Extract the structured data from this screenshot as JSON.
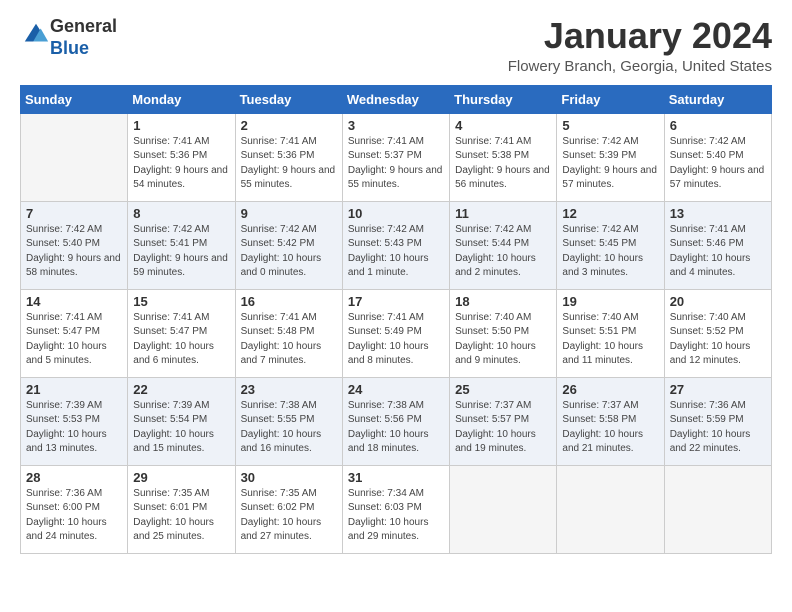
{
  "header": {
    "logo_general": "General",
    "logo_blue": "Blue",
    "title": "January 2024",
    "subtitle": "Flowery Branch, Georgia, United States"
  },
  "days_of_week": [
    "Sunday",
    "Monday",
    "Tuesday",
    "Wednesday",
    "Thursday",
    "Friday",
    "Saturday"
  ],
  "weeks": [
    [
      {
        "day": "",
        "sunrise": "",
        "sunset": "",
        "daylight": "",
        "empty": true
      },
      {
        "day": "1",
        "sunrise": "Sunrise: 7:41 AM",
        "sunset": "Sunset: 5:36 PM",
        "daylight": "Daylight: 9 hours and 54 minutes."
      },
      {
        "day": "2",
        "sunrise": "Sunrise: 7:41 AM",
        "sunset": "Sunset: 5:36 PM",
        "daylight": "Daylight: 9 hours and 55 minutes."
      },
      {
        "day": "3",
        "sunrise": "Sunrise: 7:41 AM",
        "sunset": "Sunset: 5:37 PM",
        "daylight": "Daylight: 9 hours and 55 minutes."
      },
      {
        "day": "4",
        "sunrise": "Sunrise: 7:41 AM",
        "sunset": "Sunset: 5:38 PM",
        "daylight": "Daylight: 9 hours and 56 minutes."
      },
      {
        "day": "5",
        "sunrise": "Sunrise: 7:42 AM",
        "sunset": "Sunset: 5:39 PM",
        "daylight": "Daylight: 9 hours and 57 minutes."
      },
      {
        "day": "6",
        "sunrise": "Sunrise: 7:42 AM",
        "sunset": "Sunset: 5:40 PM",
        "daylight": "Daylight: 9 hours and 57 minutes."
      }
    ],
    [
      {
        "day": "7",
        "sunrise": "Sunrise: 7:42 AM",
        "sunset": "Sunset: 5:40 PM",
        "daylight": "Daylight: 9 hours and 58 minutes."
      },
      {
        "day": "8",
        "sunrise": "Sunrise: 7:42 AM",
        "sunset": "Sunset: 5:41 PM",
        "daylight": "Daylight: 9 hours and 59 minutes."
      },
      {
        "day": "9",
        "sunrise": "Sunrise: 7:42 AM",
        "sunset": "Sunset: 5:42 PM",
        "daylight": "Daylight: 10 hours and 0 minutes."
      },
      {
        "day": "10",
        "sunrise": "Sunrise: 7:42 AM",
        "sunset": "Sunset: 5:43 PM",
        "daylight": "Daylight: 10 hours and 1 minute."
      },
      {
        "day": "11",
        "sunrise": "Sunrise: 7:42 AM",
        "sunset": "Sunset: 5:44 PM",
        "daylight": "Daylight: 10 hours and 2 minutes."
      },
      {
        "day": "12",
        "sunrise": "Sunrise: 7:42 AM",
        "sunset": "Sunset: 5:45 PM",
        "daylight": "Daylight: 10 hours and 3 minutes."
      },
      {
        "day": "13",
        "sunrise": "Sunrise: 7:41 AM",
        "sunset": "Sunset: 5:46 PM",
        "daylight": "Daylight: 10 hours and 4 minutes."
      }
    ],
    [
      {
        "day": "14",
        "sunrise": "Sunrise: 7:41 AM",
        "sunset": "Sunset: 5:47 PM",
        "daylight": "Daylight: 10 hours and 5 minutes."
      },
      {
        "day": "15",
        "sunrise": "Sunrise: 7:41 AM",
        "sunset": "Sunset: 5:47 PM",
        "daylight": "Daylight: 10 hours and 6 minutes."
      },
      {
        "day": "16",
        "sunrise": "Sunrise: 7:41 AM",
        "sunset": "Sunset: 5:48 PM",
        "daylight": "Daylight: 10 hours and 7 minutes."
      },
      {
        "day": "17",
        "sunrise": "Sunrise: 7:41 AM",
        "sunset": "Sunset: 5:49 PM",
        "daylight": "Daylight: 10 hours and 8 minutes."
      },
      {
        "day": "18",
        "sunrise": "Sunrise: 7:40 AM",
        "sunset": "Sunset: 5:50 PM",
        "daylight": "Daylight: 10 hours and 9 minutes."
      },
      {
        "day": "19",
        "sunrise": "Sunrise: 7:40 AM",
        "sunset": "Sunset: 5:51 PM",
        "daylight": "Daylight: 10 hours and 11 minutes."
      },
      {
        "day": "20",
        "sunrise": "Sunrise: 7:40 AM",
        "sunset": "Sunset: 5:52 PM",
        "daylight": "Daylight: 10 hours and 12 minutes."
      }
    ],
    [
      {
        "day": "21",
        "sunrise": "Sunrise: 7:39 AM",
        "sunset": "Sunset: 5:53 PM",
        "daylight": "Daylight: 10 hours and 13 minutes."
      },
      {
        "day": "22",
        "sunrise": "Sunrise: 7:39 AM",
        "sunset": "Sunset: 5:54 PM",
        "daylight": "Daylight: 10 hours and 15 minutes."
      },
      {
        "day": "23",
        "sunrise": "Sunrise: 7:38 AM",
        "sunset": "Sunset: 5:55 PM",
        "daylight": "Daylight: 10 hours and 16 minutes."
      },
      {
        "day": "24",
        "sunrise": "Sunrise: 7:38 AM",
        "sunset": "Sunset: 5:56 PM",
        "daylight": "Daylight: 10 hours and 18 minutes."
      },
      {
        "day": "25",
        "sunrise": "Sunrise: 7:37 AM",
        "sunset": "Sunset: 5:57 PM",
        "daylight": "Daylight: 10 hours and 19 minutes."
      },
      {
        "day": "26",
        "sunrise": "Sunrise: 7:37 AM",
        "sunset": "Sunset: 5:58 PM",
        "daylight": "Daylight: 10 hours and 21 minutes."
      },
      {
        "day": "27",
        "sunrise": "Sunrise: 7:36 AM",
        "sunset": "Sunset: 5:59 PM",
        "daylight": "Daylight: 10 hours and 22 minutes."
      }
    ],
    [
      {
        "day": "28",
        "sunrise": "Sunrise: 7:36 AM",
        "sunset": "Sunset: 6:00 PM",
        "daylight": "Daylight: 10 hours and 24 minutes."
      },
      {
        "day": "29",
        "sunrise": "Sunrise: 7:35 AM",
        "sunset": "Sunset: 6:01 PM",
        "daylight": "Daylight: 10 hours and 25 minutes."
      },
      {
        "day": "30",
        "sunrise": "Sunrise: 7:35 AM",
        "sunset": "Sunset: 6:02 PM",
        "daylight": "Daylight: 10 hours and 27 minutes."
      },
      {
        "day": "31",
        "sunrise": "Sunrise: 7:34 AM",
        "sunset": "Sunset: 6:03 PM",
        "daylight": "Daylight: 10 hours and 29 minutes."
      },
      {
        "day": "",
        "sunrise": "",
        "sunset": "",
        "daylight": "",
        "empty": true
      },
      {
        "day": "",
        "sunrise": "",
        "sunset": "",
        "daylight": "",
        "empty": true
      },
      {
        "day": "",
        "sunrise": "",
        "sunset": "",
        "daylight": "",
        "empty": true
      }
    ]
  ]
}
